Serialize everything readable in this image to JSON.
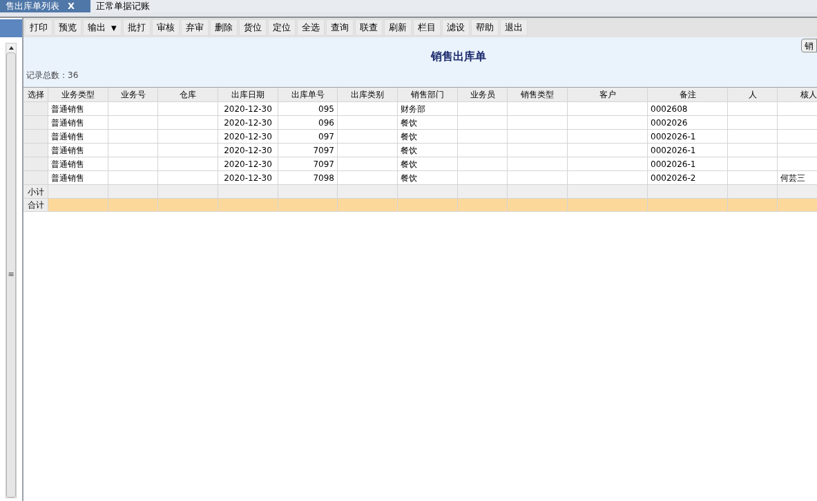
{
  "tabs": [
    {
      "label": "售出库单列表",
      "close": "X",
      "selected": true
    },
    {
      "label": "正常单据记账",
      "selected": false
    }
  ],
  "left_panel": {
    "scroll_grip": "≡"
  },
  "toolbar": [
    {
      "label": "打印"
    },
    {
      "label": "预览"
    },
    {
      "label": "输出",
      "dropdown": "▼"
    },
    {
      "label": "批打"
    },
    {
      "label": "审核"
    },
    {
      "label": "弃审"
    },
    {
      "label": "删除"
    },
    {
      "label": "货位"
    },
    {
      "label": "定位"
    },
    {
      "label": "全选"
    },
    {
      "label": "查询"
    },
    {
      "label": "联查"
    },
    {
      "label": "刷新"
    },
    {
      "label": "栏目"
    },
    {
      "label": "滤设"
    },
    {
      "label": "帮助"
    },
    {
      "label": "退出"
    }
  ],
  "title": "销售出库单",
  "side_button": "销",
  "record_count": "记录总数：36",
  "table": {
    "columns": [
      "选择",
      "业务类型",
      "业务号",
      "仓库",
      "出库日期",
      "出库单号",
      "出库类别",
      "销售部门",
      "业务员",
      "销售类型",
      "客户",
      "备注",
      "人",
      "核人"
    ],
    "rows": [
      [
        "",
        "普通销售",
        "",
        "",
        "2020-12-30",
        "095",
        "",
        "财务部",
        "",
        "",
        "",
        "0002608",
        "",
        ""
      ],
      [
        "",
        "普通销售",
        "",
        "",
        "2020-12-30",
        "096",
        "",
        "餐饮",
        "",
        "",
        "",
        "0002026",
        "",
        ""
      ],
      [
        "",
        "普通销售",
        "",
        "",
        "2020-12-30",
        "097",
        "",
        "餐饮",
        "",
        "",
        "",
        "0002026-1",
        "",
        ""
      ],
      [
        "",
        "普通销售",
        "",
        "",
        "2020-12-30",
        "7097",
        "",
        "餐饮",
        "",
        "",
        "",
        "0002026-1",
        "",
        ""
      ],
      [
        "",
        "普通销售",
        "",
        "",
        "2020-12-30",
        "7097",
        "",
        "餐饮",
        "",
        "",
        "",
        "0002026-1",
        "",
        ""
      ],
      [
        "",
        "普通销售",
        "",
        "",
        "2020-12-30",
        "7098",
        "",
        "餐饮",
        "",
        "",
        "",
        "0002026-2",
        "",
        "何芸三"
      ]
    ],
    "subtotal_label": "小计",
    "total_label": "合计"
  }
}
